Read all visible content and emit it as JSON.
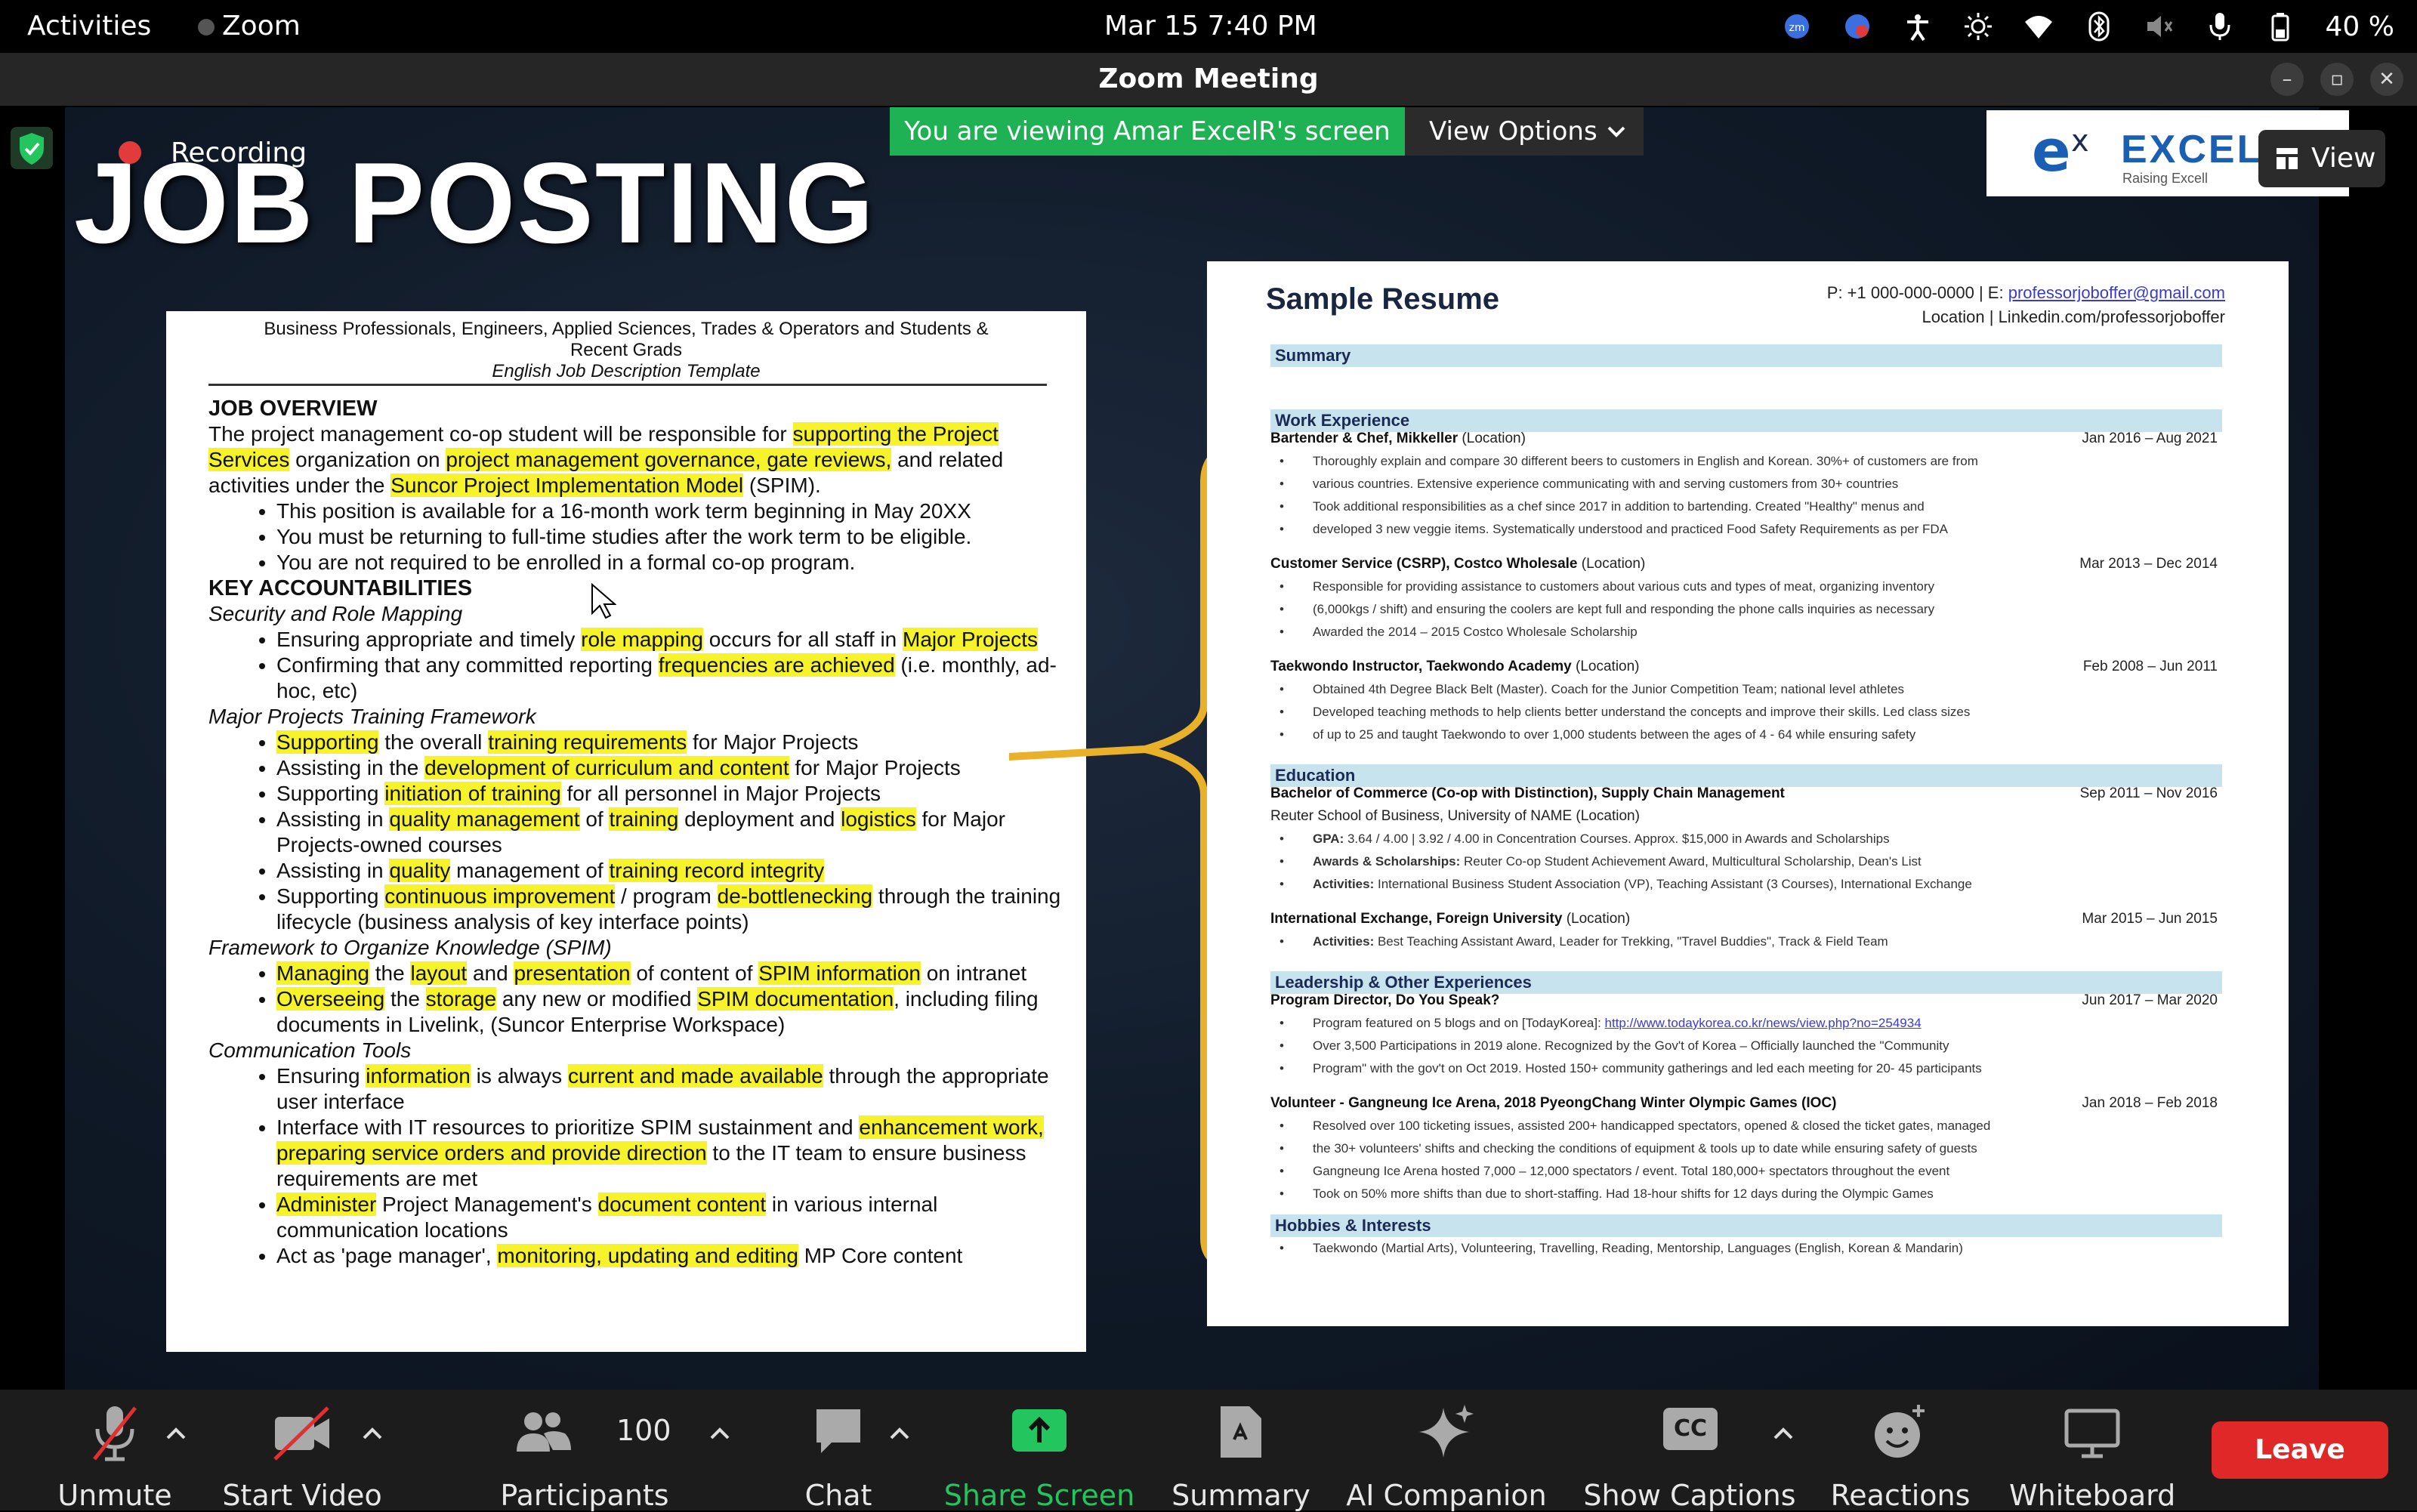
{
  "topbar": {
    "activities": "Activities",
    "app_name": "Zoom",
    "datetime": "Mar 15  7:40 PM",
    "battery": "40 %"
  },
  "window": {
    "title": "Zoom Meeting"
  },
  "overlay": {
    "recording": "Recording",
    "banner": "You are viewing Amar ExcelR's screen",
    "view_options": "View Options",
    "view_button": "View",
    "logo_text": "EXCEL",
    "logo_tagline": "Raising Excell"
  },
  "slide": {
    "title": "JOB POSTING",
    "job_doc": {
      "header_line1": "Business Professionals, Engineers, Applied Sciences, Trades & Operators and Students &",
      "header_line2": "Recent Grads",
      "header_line3": "English Job Description Template",
      "overview_heading": "JOB OVERVIEW",
      "key_heading": "KEY ACCOUNTABILITIES",
      "sub_security": "Security and Role Mapping",
      "sub_training": "Major Projects Training Framework",
      "sub_framework": "Framework to Organize Knowledge (SPIM)",
      "sub_comm": "Communication Tools"
    },
    "resume": {
      "title": "Sample Resume",
      "contact_line1": "P: +1 000-000-0000 | E:",
      "email": "professorjoboffer@gmail.com",
      "contact_line2": "Location | Linkedin.com/professorjoboffer",
      "sections": {
        "summary": "Summary",
        "work": "Work Experience",
        "education": "Education",
        "leadership": "Leadership & Other Experiences",
        "hobbies": "Hobbies & Interests"
      },
      "jobs": [
        {
          "title": "Bartender & Chef, Mikkeller",
          "loc": "(Location)",
          "dates": "Jan 2016 – Aug 2021"
        },
        {
          "title": "Customer Service (CSRP), Costco Wholesale",
          "loc": "(Location)",
          "dates": "Mar 2013 – Dec 2014"
        },
        {
          "title": "Taekwondo Instructor, Taekwondo Academy",
          "loc": "(Location)",
          "dates": "Feb 2008 – Jun 2011"
        }
      ],
      "edu": [
        {
          "title": "Bachelor of Commerce (Co-op with Distinction), Supply Chain Management",
          "dates": "Sep 2011 – Nov 2016",
          "sub": "Reuter School of Business, University of NAME (Location)"
        },
        {
          "title": "International Exchange, Foreign University",
          "loc": "(Location)",
          "dates": "Mar 2015 – Jun 2015"
        }
      ],
      "lead": [
        {
          "title": "Program Director, Do You Speak?",
          "dates": "Jun 2017 – Mar 2020"
        },
        {
          "title": "Volunteer - Gangneung Ice Arena, 2018 PyeongChang Winter Olympic Games (IOC)",
          "dates": "Jan 2018 – Feb 2018"
        }
      ]
    }
  },
  "toolbar": {
    "unmute": "Unmute",
    "start_video": "Start Video",
    "participants": "Participants",
    "participants_count": "100",
    "chat": "Chat",
    "share_screen": "Share Screen",
    "summary": "Summary",
    "ai_companion": "AI Companion",
    "show_captions": "Show Captions",
    "captions_badge": "CC",
    "reactions": "Reactions",
    "whiteboard": "Whiteboard",
    "leave": "Leave"
  },
  "colors": {
    "share_green": "#1fb254",
    "leave_red": "#e02828",
    "highlight": "#f7f32b",
    "bracket": "#e9b02a"
  }
}
